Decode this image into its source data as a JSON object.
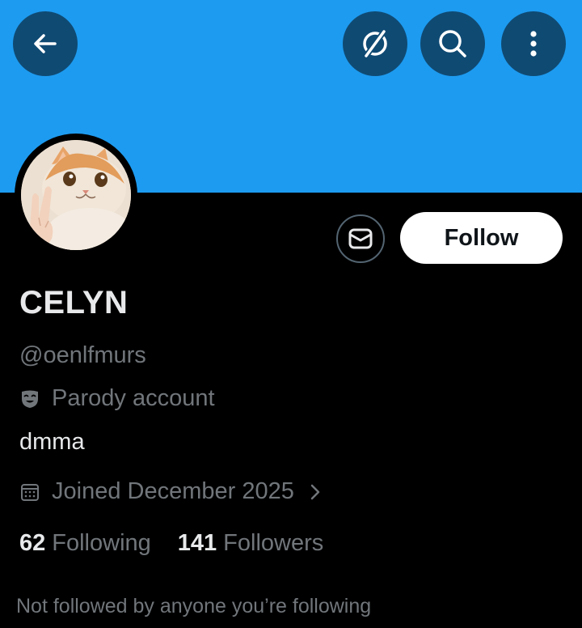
{
  "header": {
    "back_icon": "arrow-left-icon",
    "grok_icon": "grok-icon",
    "search_icon": "search-icon",
    "more_icon": "more-vertical-icon",
    "banner_color": "#1d9bf0",
    "button_color": "#0f4a73"
  },
  "profile": {
    "avatar_description": "cat-photo-avatar",
    "display_name": "CELYN",
    "handle": "@oenlfmurs",
    "parody_label": "Parody account",
    "bio": "dmma",
    "joined": "Joined December 2025",
    "following_count": "62",
    "following_label": "Following",
    "followers_count": "141",
    "followers_label": "Followers",
    "social_context": "Not followed by anyone you’re following"
  },
  "actions": {
    "message_icon": "envelope-icon",
    "follow_label": "Follow"
  }
}
